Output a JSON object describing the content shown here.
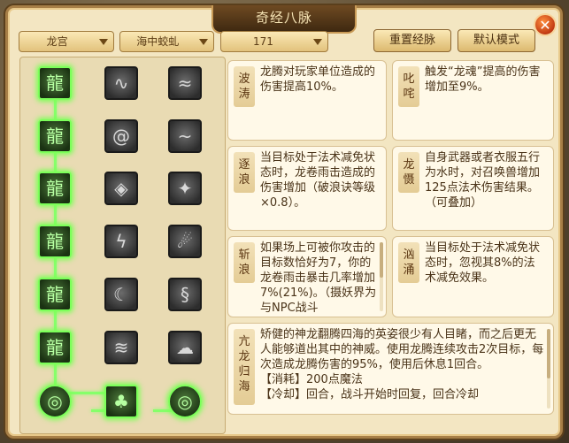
{
  "window": {
    "title": "奇经八脉",
    "close_label": "✕"
  },
  "controls": {
    "school_dropdown": "龙宫",
    "path_dropdown": "海中蛟虬",
    "level_dropdown": "171",
    "reset_button": "重置经脉",
    "default_button": "默认模式"
  },
  "skill_grid": {
    "columns": 3,
    "rows": [
      [
        {
          "icon": "dragon-water-icon",
          "active": true
        },
        {
          "icon": "dragon-coil-icon",
          "active": false
        },
        {
          "icon": "wave-swirl-icon",
          "active": false
        }
      ],
      [
        {
          "icon": "dragon-wave-icon",
          "active": true
        },
        {
          "icon": "spiral-cloud-icon",
          "active": false
        },
        {
          "icon": "wind-curl-icon",
          "active": false
        }
      ],
      [
        {
          "icon": "dragon-roar-icon",
          "active": true
        },
        {
          "icon": "ancient-glyph-icon",
          "active": false
        },
        {
          "icon": "dark-bird-icon",
          "active": false
        }
      ],
      [
        {
          "icon": "dragon-claw-icon",
          "active": true
        },
        {
          "icon": "lightning-branch-icon",
          "active": false
        },
        {
          "icon": "comet-icon",
          "active": false
        }
      ],
      [
        {
          "icon": "dragon-tail-icon",
          "active": true
        },
        {
          "icon": "crescent-moon-icon",
          "active": false
        },
        {
          "icon": "twin-dragon-icon",
          "active": false
        }
      ],
      [
        {
          "icon": "dragon-storm-icon",
          "active": true
        },
        {
          "icon": "wave-crest-icon",
          "active": false
        },
        {
          "icon": "rain-cloud-icon",
          "active": false
        }
      ],
      [
        {
          "icon": "dragon-orb-icon",
          "active": true,
          "round": true
        },
        {
          "icon": "dragon-tree-icon",
          "active": true
        },
        {
          "icon": "dragon-orb-icon",
          "active": true,
          "round": true
        }
      ]
    ]
  },
  "cards": [
    {
      "tag": "波涛",
      "text": "龙腾对玩家单位造成的伤害提高10%。"
    },
    {
      "tag": "叱咤",
      "text": "触发“龙魂”提高的伤害增加至9%。"
    },
    {
      "tag": "逐浪",
      "text": "当目标处于法术减免状态时，龙卷雨击造成的伤害增加（破浪诀等级×0.8）。"
    },
    {
      "tag": "龙慑",
      "text": "自身武器或者衣服五行为水时，对召唤兽增加125点法术伤害结果。（可叠加）"
    },
    {
      "tag": "斩浪",
      "text": "如果场上可被你攻击的目标数恰好为7，你的龙卷雨击暴击几率增加7%(21%)。（摄妖界为与NPC战斗"
    },
    {
      "tag": "汹涌",
      "text": "当目标处于法术减免状态时，忽视其8%的法术减免效果。"
    },
    {
      "tag": "亢龙归海",
      "text": "矫健的神龙翻腾四海的英姿很少有人目睹，而之后更无人能够道出其中的神威。使用龙腾连续攻击2次目标，每次造成龙腾伤害的95%，使用后休息1回合。",
      "cost_label": "【消耗】200点魔法",
      "extra": "【冷却】回合，战斗开始时回复，回合冷却"
    }
  ]
}
